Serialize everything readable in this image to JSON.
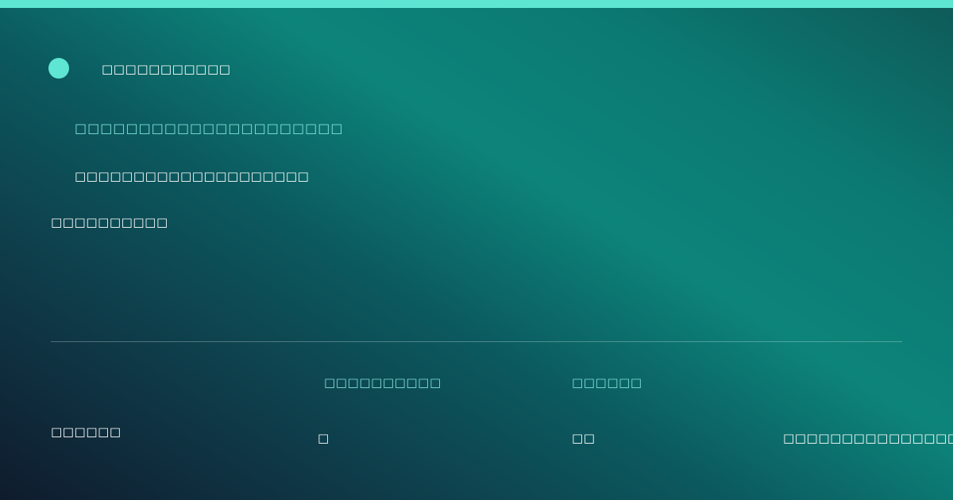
{
  "header": {
    "brand": "□□□□□□□□□□□"
  },
  "main": {
    "line1": "□□□□□□□□□□□□□□□□□□□□□",
    "line2": "□□□□□□□□□□□□□□□□□□□□",
    "line3": "□□□□□□□□□□"
  },
  "footer": {
    "left": "□□□□□□",
    "stats": [
      {
        "label": "□□□□□□□□□□",
        "value": "□"
      },
      {
        "label": "□□□□□□",
        "value": "□□"
      }
    ],
    "right": "□□□□□□□□□□□□□□□"
  },
  "colors": {
    "accent": "#5fe6d3",
    "accent_text": "#7fe3d8",
    "text": "#ffffff"
  }
}
